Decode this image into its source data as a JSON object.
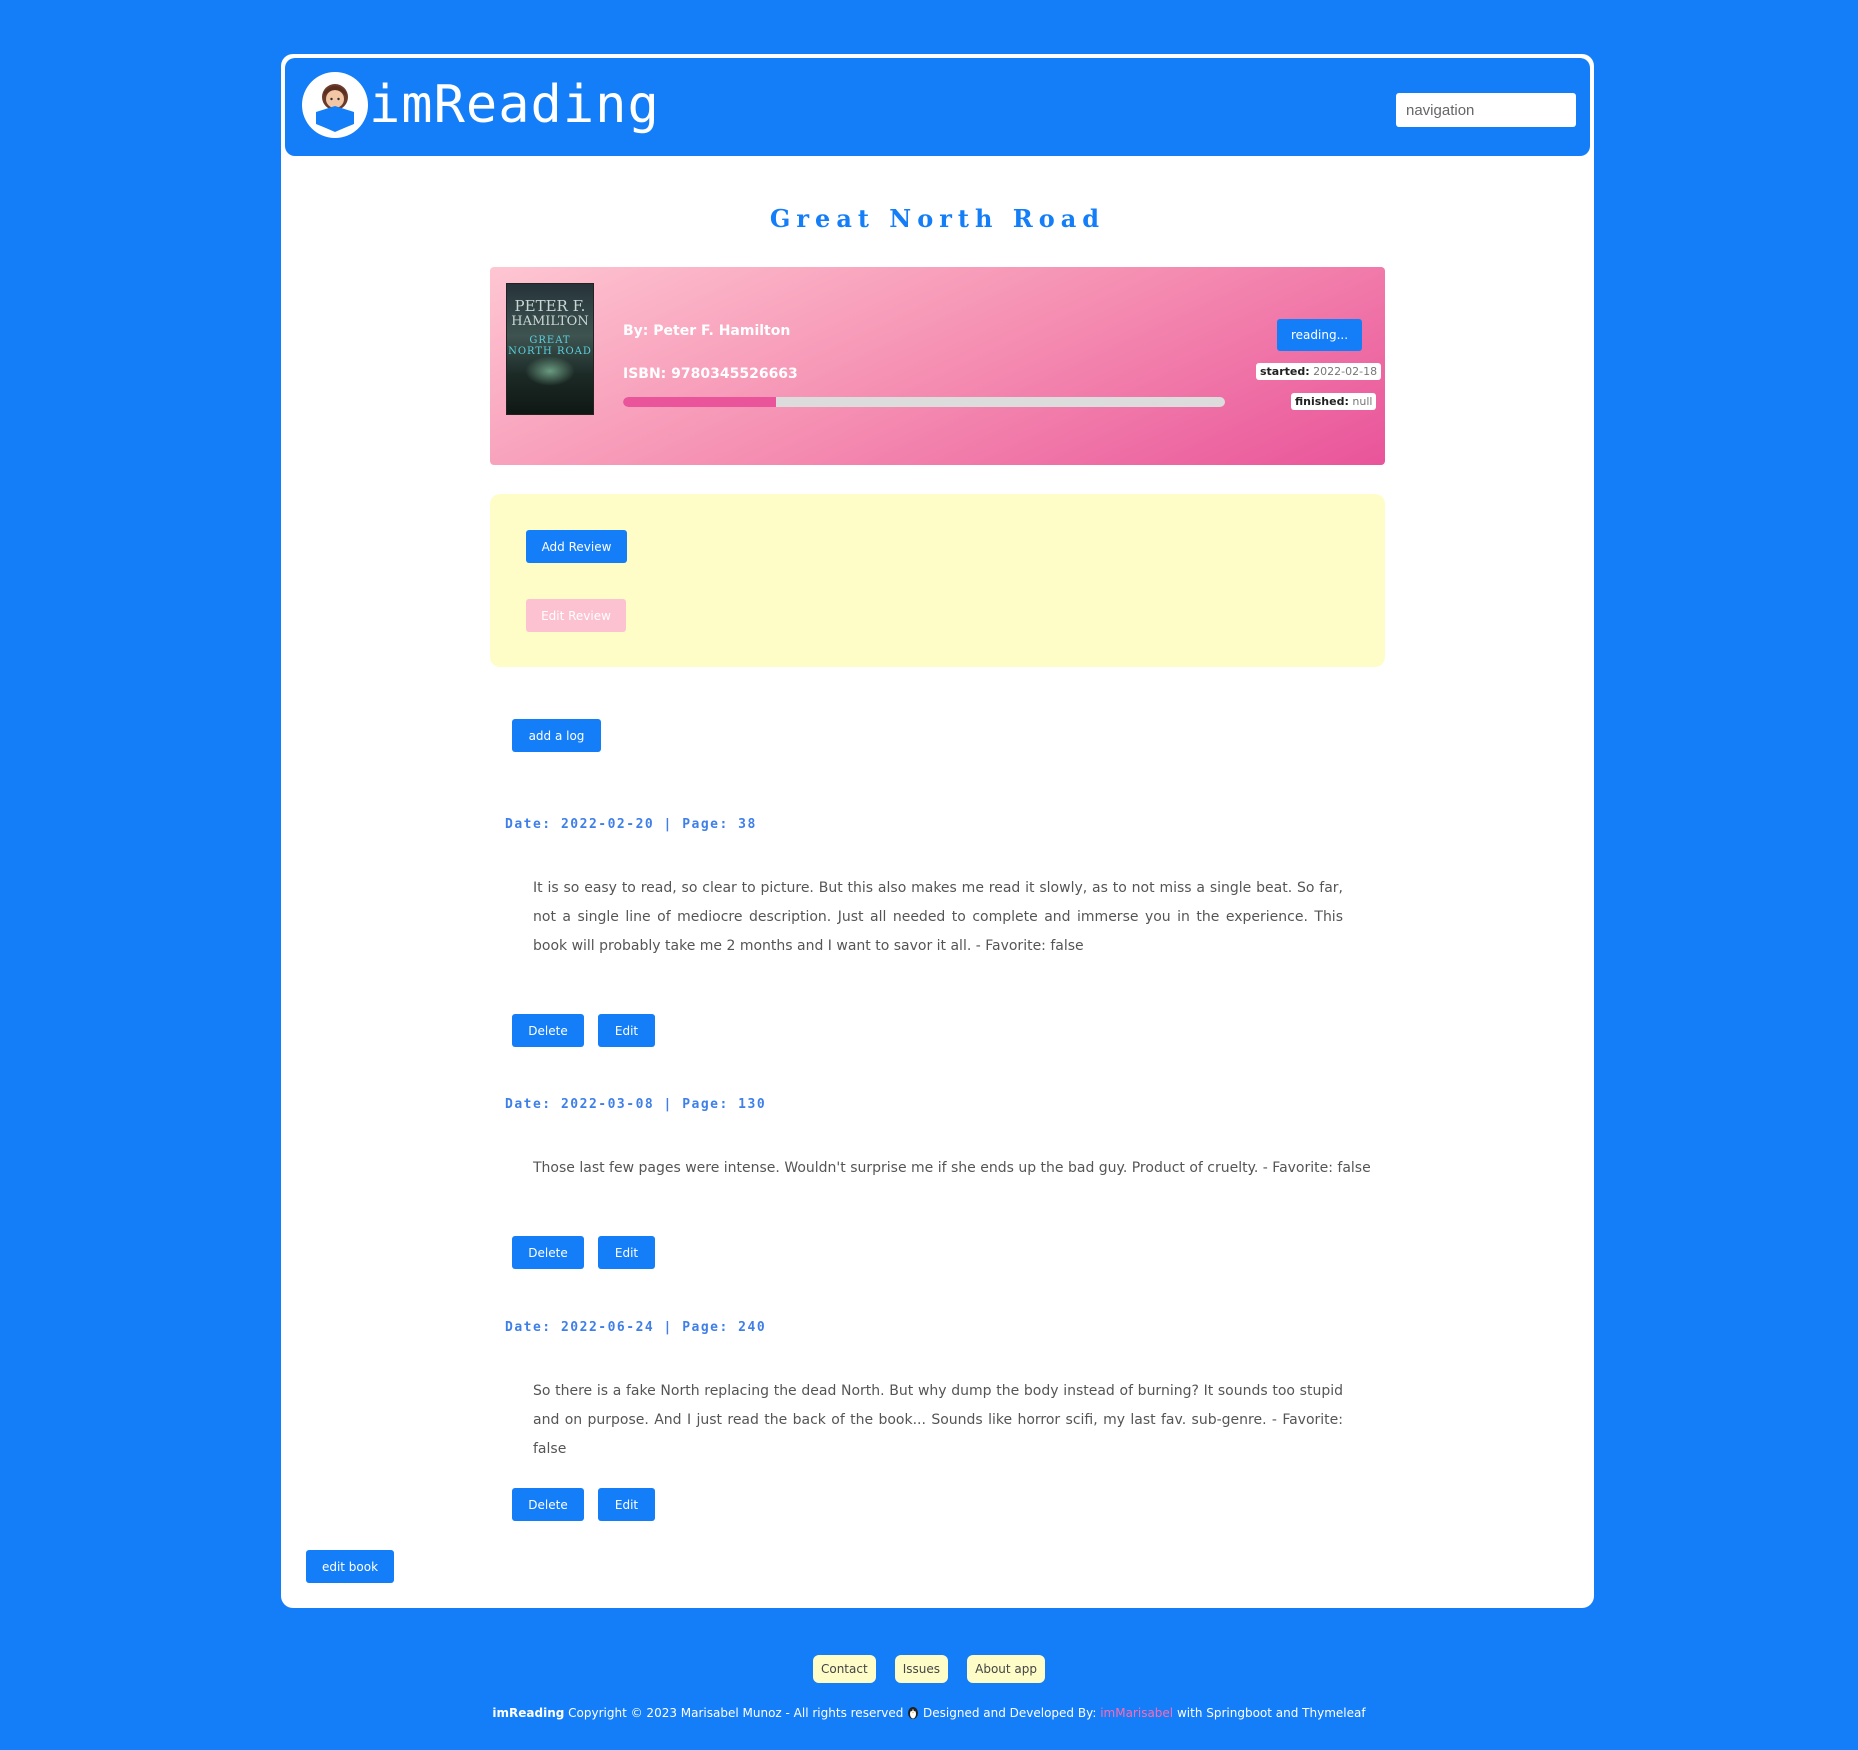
{
  "header": {
    "app_name": "imReading",
    "nav_placeholder": "navigation"
  },
  "book": {
    "title": "Great North Road",
    "cover": {
      "author_line1": "PETER F.",
      "author_line2": "HAMILTON",
      "title_text": "GREAT NORTH ROAD"
    },
    "author": "By: Peter F. Hamilton",
    "isbn": "ISBN: 9780345526663",
    "progress_fraction": 0.254,
    "status_label": "reading...",
    "started_label": "started:",
    "started_value": "2022-02-18",
    "finished_label": "finished:",
    "finished_value": "null"
  },
  "review": {
    "add_label": "Add Review",
    "edit_label": "Edit Review"
  },
  "add_log_label": "add a log",
  "logs": [
    {
      "header": "Date: 2022-02-20 | Page: 38",
      "text": "It is so easy to read, so clear to picture. But this also makes me read it slowly, as to not miss a single beat. So far, not a single line of mediocre description. Just all needed to complete and immerse you in the experience. This book will probably take me 2 months and I want to savor it all. - Favorite: false",
      "delete_label": "Delete",
      "edit_label": "Edit"
    },
    {
      "header": "Date: 2022-03-08 | Page: 130",
      "text": "Those last few pages were intense. Wouldn't surprise me if she ends up the bad guy. Product of cruelty. - Favorite: false",
      "delete_label": "Delete",
      "edit_label": "Edit"
    },
    {
      "header": "Date: 2022-06-24 | Page: 240",
      "text": "So there is a fake North replacing the dead North. But why dump the body instead of burning? It sounds too stupid and on purpose. And I just read the back of the book... Sounds like horror scifi, my last fav. sub-genre. - Favorite: false",
      "delete_label": "Delete",
      "edit_label": "Edit"
    }
  ],
  "edit_book_label": "edit book",
  "footer": {
    "links": [
      "Contact",
      "Issues",
      "About app"
    ],
    "brand": "imReading",
    "copyright": "Copyright © 2023 Marisabel Munoz - All rights reserved",
    "designed_by": "Designed and Developed By:",
    "developer": "imMarisabel",
    "tech": "with Springboot and Thymeleaf"
  },
  "colors": {
    "primary": "#147ef8",
    "pink": "#e9549a",
    "review_bg": "#fefdc8",
    "developer_link": "#ff69b4"
  },
  "icons": {
    "logo": "girl-reading-book-icon",
    "footer_avatar": "penguin-avatar-icon"
  }
}
